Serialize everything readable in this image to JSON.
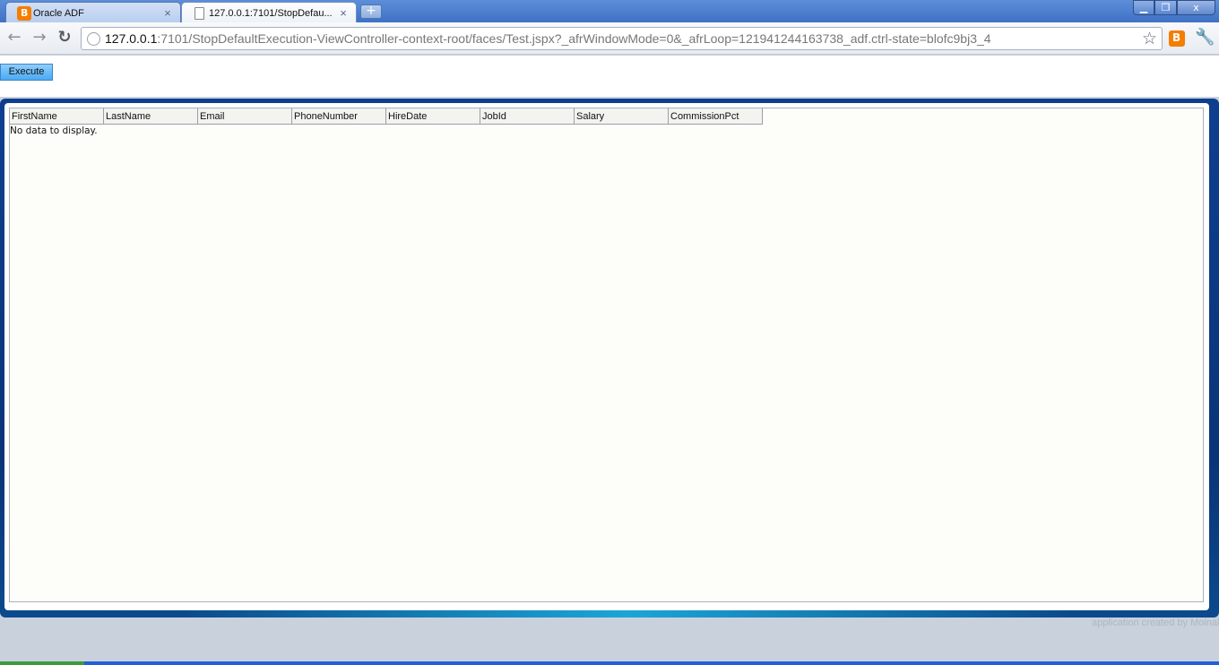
{
  "browser": {
    "tabs": [
      {
        "label": "Oracle ADF",
        "icon": "blogger-icon",
        "active": false
      },
      {
        "label": "127.0.0.1:7101/StopDefau...",
        "icon": "page-icon",
        "active": true
      }
    ],
    "new_tab_label": "+",
    "url_host": "127.0.0.1",
    "url_rest": ":7101/StopDefaultExecution-ViewController-context-root/faces/Test.jspx?_afrWindowMode=0&_afrLoop=121941244163738_adf.ctrl-state=blofc9bj3_4",
    "window_controls": {
      "minimize": "▁",
      "maximize": "❐",
      "close": "x"
    }
  },
  "page": {
    "execute_label": "Execute",
    "table": {
      "columns": [
        "FirstName",
        "LastName",
        "Email",
        "PhoneNumber",
        "HireDate",
        "JobId",
        "Salary",
        "CommissionPct"
      ],
      "empty_text": "No data to display."
    },
    "footer_credit": "application created by Moinak"
  },
  "colors": {
    "accent": "#0a3478",
    "button": "#4aaaf4",
    "blogger": "#f57d00"
  }
}
